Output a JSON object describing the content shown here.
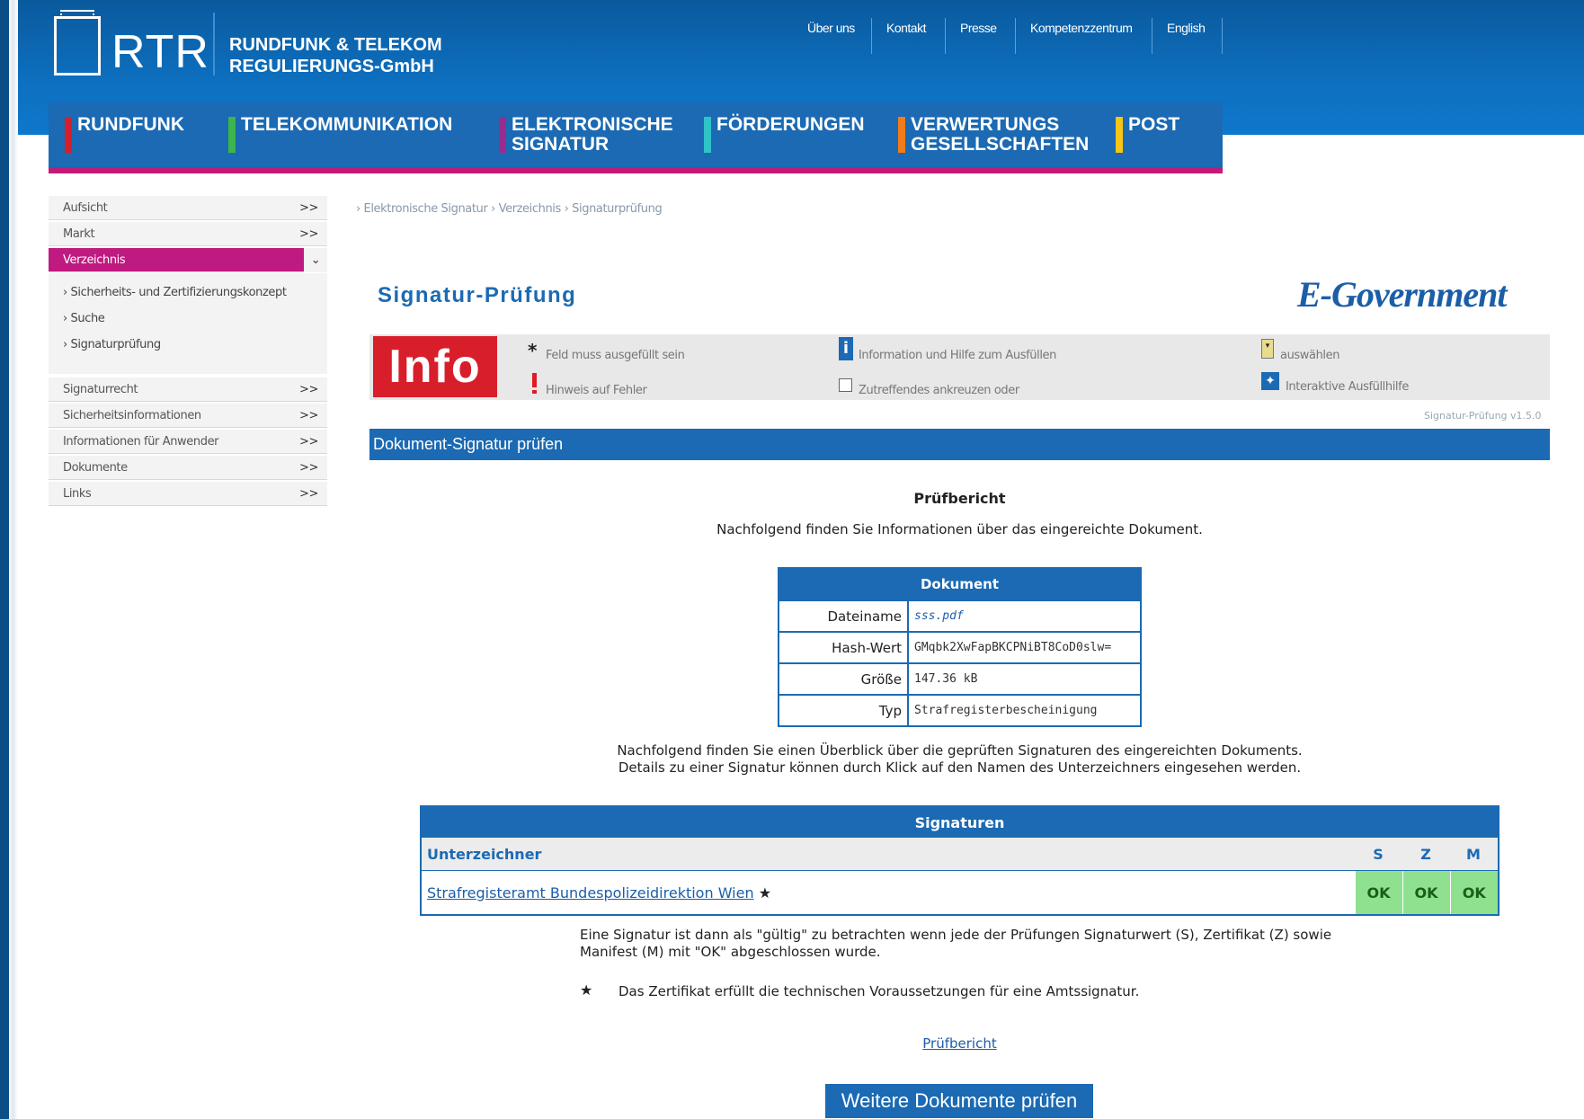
{
  "header": {
    "logo_text": "RTR",
    "org_line1": "RUNDFUNK & TELEKOM",
    "org_line2": "REGULIERUNGS-GmbH",
    "top_links": [
      "Über uns",
      "Kontakt",
      "Presse",
      "Kompetenzzentrum",
      "English"
    ]
  },
  "mainnav": {
    "items": [
      {
        "label1": "RUNDFUNK",
        "label2": "",
        "color": "#d81e2a"
      },
      {
        "label1": "TELEKOMMUNIKATION",
        "label2": "",
        "color": "#3cb54a"
      },
      {
        "label1": "ELEKTRONISCHE",
        "label2": "SIGNATUR",
        "color": "#9b2c8f"
      },
      {
        "label1": "FÖRDERUNGEN",
        "label2": "",
        "color": "#2ec4c8"
      },
      {
        "label1": "VERWERTUNGS",
        "label2": "GESELLSCHAFTEN",
        "color": "#f07c1a"
      },
      {
        "label1": "POST",
        "label2": "",
        "color": "#f5c518"
      }
    ]
  },
  "sidebar": {
    "arrow": ">>",
    "active_arrow": "⌄",
    "items": [
      "Aufsicht",
      "Markt",
      "Verzeichnis",
      "Signaturrecht",
      "Sicherheitsinformationen",
      "Informationen für Anwender",
      "Dokumente",
      "Links"
    ],
    "subitems": [
      "Sicherheits- und Zertifizierungskonzept",
      "Suche",
      "Signaturprüfung"
    ]
  },
  "breadcrumb": [
    "Elektronische Signatur",
    "Verzeichnis",
    "Signaturprüfung"
  ],
  "page": {
    "title": "Signatur-Prüfung",
    "brand": "E-Government",
    "info_logo": "Info",
    "legend": {
      "required": "Feld muss ausgefüllt sein",
      "error": "Hinweis auf Fehler",
      "info": "Information und Hilfe zum Ausfüllen",
      "check": "Zutreffendes ankreuzen oder",
      "select": "auswählen",
      "interactive": "Interaktive Ausfüllhilfe"
    },
    "version": "Signatur-Prüfung v1.5.0",
    "section_title": "Dokument-Signatur prüfen"
  },
  "report": {
    "heading": "Prüfbericht",
    "intro": "Nachfolgend finden Sie Informationen über das eingereichte Dokument.",
    "doc_table": {
      "header": "Dokument",
      "rows": [
        {
          "label": "Dateiname",
          "value": "sss.pdf"
        },
        {
          "label": "Hash-Wert",
          "value": "GMqbk2XwFapBKCPNiBT8CoD0slw="
        },
        {
          "label": "Größe",
          "value": "147.36 kB"
        },
        {
          "label": "Typ",
          "value": "Strafregisterbescheinigung"
        }
      ]
    },
    "overview_line1": "Nachfolgend finden Sie einen Überblick über die geprüften Signaturen des eingereichten Dokuments.",
    "overview_line2": "Details zu einer Signatur können durch Klick auf den Namen des Unterzeichners eingesehen werden.",
    "sig_table": {
      "header": "Signaturen",
      "col_signer": "Unterzeichner",
      "col_s": "S",
      "col_z": "Z",
      "col_m": "M",
      "signer": "Strafregisteramt Bundespolizeidirektion Wien",
      "signer_mark": "★",
      "s": "OK",
      "z": "OK",
      "m": "OK"
    },
    "validity_line1": "Eine Signatur ist dann als \"gültig\" zu betrachten wenn jede der Prüfungen Signaturwert (S), Zertifikat (Z) sowie",
    "validity_line2": "Manifest (M) mit \"OK\" abgeschlossen wurde.",
    "footnote_mark": "★",
    "footnote": "Das Zertifikat erfüllt die technischen Voraussetzungen für eine Amtssignatur.",
    "report_link": "Prüfbericht",
    "more_button": "Weitere Dokumente prüfen"
  }
}
